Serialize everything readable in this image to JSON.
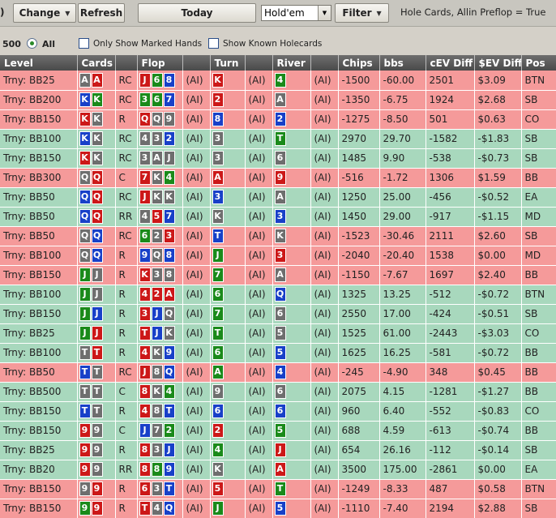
{
  "toolbar": {
    "paren": ")",
    "change_label": "Change",
    "refresh_label": "Refresh",
    "today_label": "Today",
    "game_select": "Hold'em",
    "filter_label": "Filter",
    "filter_desc": "Hole Cards, Allin Preflop = True"
  },
  "options": {
    "count": "500",
    "all_label": "All",
    "marked_label": "Only Show Marked Hands",
    "known_label": "Show Known Holecards"
  },
  "columns": [
    "Level",
    "Cards",
    "",
    "Flop",
    "",
    "Turn",
    "",
    "River",
    "",
    "Chips",
    "bbs",
    "cEV Diff",
    "$EV Diff",
    "Pos"
  ],
  "colors": {
    "spade": "#6e6e6e",
    "heart": "#cc1818",
    "diamond": "#1840c8",
    "club": "#1a8a1a",
    "loss_row": "#f59a9a",
    "win_row": "#a8d8bd"
  },
  "rows": [
    {
      "level": "Trny: BB25",
      "hole": [
        [
          "A",
          "s"
        ],
        [
          "A",
          "h"
        ]
      ],
      "pre": "RC",
      "flop": [
        [
          "J",
          "h"
        ],
        [
          "6",
          "c"
        ],
        [
          "8",
          "d"
        ]
      ],
      "a1": "(AI)",
      "turn": [
        [
          "K",
          "h"
        ]
      ],
      "a2": "(AI)",
      "river": [
        [
          "4",
          "c"
        ]
      ],
      "a3": "(AI)",
      "chips": "-1500",
      "bbs": "-60.00",
      "cev": "2501",
      "dev": "$3.09",
      "pos": "BTN",
      "res": "loss"
    },
    {
      "level": "Trny: BB200",
      "hole": [
        [
          "K",
          "d"
        ],
        [
          "K",
          "c"
        ]
      ],
      "pre": "RC",
      "flop": [
        [
          "3",
          "c"
        ],
        [
          "6",
          "c"
        ],
        [
          "7",
          "d"
        ]
      ],
      "a1": "(AI)",
      "turn": [
        [
          "2",
          "h"
        ]
      ],
      "a2": "(AI)",
      "river": [
        [
          "A",
          "s"
        ]
      ],
      "a3": "(AI)",
      "chips": "-1350",
      "bbs": "-6.75",
      "cev": "1924",
      "dev": "$2.68",
      "pos": "SB",
      "res": "loss"
    },
    {
      "level": "Trny: BB150",
      "hole": [
        [
          "K",
          "h"
        ],
        [
          "K",
          "s"
        ]
      ],
      "pre": "R",
      "flop": [
        [
          "Q",
          "h"
        ],
        [
          "Q",
          "s"
        ],
        [
          "9",
          "s"
        ]
      ],
      "a1": "(AI)",
      "turn": [
        [
          "8",
          "d"
        ]
      ],
      "a2": "(AI)",
      "river": [
        [
          "2",
          "d"
        ]
      ],
      "a3": "(AI)",
      "chips": "-1275",
      "bbs": "-8.50",
      "cev": "501",
      "dev": "$0.63",
      "pos": "CO",
      "res": "loss"
    },
    {
      "level": "Trny: BB100",
      "hole": [
        [
          "K",
          "d"
        ],
        [
          "K",
          "s"
        ]
      ],
      "pre": "RC",
      "flop": [
        [
          "4",
          "s"
        ],
        [
          "3",
          "s"
        ],
        [
          "2",
          "d"
        ]
      ],
      "a1": "(AI)",
      "turn": [
        [
          "3",
          "s"
        ]
      ],
      "a2": "(AI)",
      "river": [
        [
          "T",
          "c"
        ]
      ],
      "a3": "(AI)",
      "chips": "2970",
      "bbs": "29.70",
      "cev": "-1582",
      "dev": "-$1.83",
      "pos": "SB",
      "res": "win"
    },
    {
      "level": "Trny: BB150",
      "hole": [
        [
          "K",
          "h"
        ],
        [
          "K",
          "s"
        ]
      ],
      "pre": "RC",
      "flop": [
        [
          "3",
          "s"
        ],
        [
          "A",
          "s"
        ],
        [
          "J",
          "s"
        ]
      ],
      "a1": "(AI)",
      "turn": [
        [
          "3",
          "s"
        ]
      ],
      "a2": "(AI)",
      "river": [
        [
          "6",
          "s"
        ]
      ],
      "a3": "(AI)",
      "chips": "1485",
      "bbs": "9.90",
      "cev": "-538",
      "dev": "-$0.73",
      "pos": "SB",
      "res": "win"
    },
    {
      "level": "Trny: BB300",
      "hole": [
        [
          "Q",
          "s"
        ],
        [
          "Q",
          "h"
        ]
      ],
      "pre": "C",
      "flop": [
        [
          "7",
          "h"
        ],
        [
          "K",
          "s"
        ],
        [
          "4",
          "c"
        ]
      ],
      "a1": "(AI)",
      "turn": [
        [
          "A",
          "h"
        ]
      ],
      "a2": "(AI)",
      "river": [
        [
          "9",
          "h"
        ]
      ],
      "a3": "(AI)",
      "chips": "-516",
      "bbs": "-1.72",
      "cev": "1306",
      "dev": "$1.59",
      "pos": "BB",
      "res": "loss"
    },
    {
      "level": "Trny: BB50",
      "hole": [
        [
          "Q",
          "d"
        ],
        [
          "Q",
          "h"
        ]
      ],
      "pre": "RC",
      "flop": [
        [
          "J",
          "h"
        ],
        [
          "K",
          "s"
        ],
        [
          "K",
          "s"
        ]
      ],
      "a1": "(AI)",
      "turn": [
        [
          "3",
          "d"
        ]
      ],
      "a2": "(AI)",
      "river": [
        [
          "A",
          "s"
        ]
      ],
      "a3": "(AI)",
      "chips": "1250",
      "bbs": "25.00",
      "cev": "-456",
      "dev": "-$0.52",
      "pos": "EA",
      "res": "win"
    },
    {
      "level": "Trny: BB50",
      "hole": [
        [
          "Q",
          "d"
        ],
        [
          "Q",
          "h"
        ]
      ],
      "pre": "RR",
      "flop": [
        [
          "4",
          "s"
        ],
        [
          "5",
          "h"
        ],
        [
          "7",
          "d"
        ]
      ],
      "a1": "(AI)",
      "turn": [
        [
          "K",
          "s"
        ]
      ],
      "a2": "(AI)",
      "river": [
        [
          "3",
          "d"
        ]
      ],
      "a3": "(AI)",
      "chips": "1450",
      "bbs": "29.00",
      "cev": "-917",
      "dev": "-$1.15",
      "pos": "MD",
      "res": "win"
    },
    {
      "level": "Trny: BB50",
      "hole": [
        [
          "Q",
          "s"
        ],
        [
          "Q",
          "d"
        ]
      ],
      "pre": "RC",
      "flop": [
        [
          "6",
          "c"
        ],
        [
          "2",
          "s"
        ],
        [
          "3",
          "h"
        ]
      ],
      "a1": "(AI)",
      "turn": [
        [
          "T",
          "d"
        ]
      ],
      "a2": "(AI)",
      "river": [
        [
          "K",
          "s"
        ]
      ],
      "a3": "(AI)",
      "chips": "-1523",
      "bbs": "-30.46",
      "cev": "2111",
      "dev": "$2.60",
      "pos": "SB",
      "res": "loss"
    },
    {
      "level": "Trny: BB100",
      "hole": [
        [
          "Q",
          "s"
        ],
        [
          "Q",
          "d"
        ]
      ],
      "pre": "R",
      "flop": [
        [
          "9",
          "d"
        ],
        [
          "Q",
          "s"
        ],
        [
          "8",
          "d"
        ]
      ],
      "a1": "(AI)",
      "turn": [
        [
          "J",
          "c"
        ]
      ],
      "a2": "(AI)",
      "river": [
        [
          "3",
          "h"
        ]
      ],
      "a3": "(AI)",
      "chips": "-2040",
      "bbs": "-20.40",
      "cev": "1538",
      "dev": "$0.00",
      "pos": "MD",
      "res": "loss"
    },
    {
      "level": "Trny: BB150",
      "hole": [
        [
          "J",
          "c"
        ],
        [
          "J",
          "s"
        ]
      ],
      "pre": "R",
      "flop": [
        [
          "K",
          "h"
        ],
        [
          "3",
          "s"
        ],
        [
          "8",
          "s"
        ]
      ],
      "a1": "(AI)",
      "turn": [
        [
          "7",
          "c"
        ]
      ],
      "a2": "(AI)",
      "river": [
        [
          "A",
          "s"
        ]
      ],
      "a3": "(AI)",
      "chips": "-1150",
      "bbs": "-7.67",
      "cev": "1697",
      "dev": "$2.40",
      "pos": "BB",
      "res": "loss"
    },
    {
      "level": "Trny: BB100",
      "hole": [
        [
          "J",
          "c"
        ],
        [
          "J",
          "s"
        ]
      ],
      "pre": "R",
      "flop": [
        [
          "4",
          "h"
        ],
        [
          "2",
          "h"
        ],
        [
          "A",
          "h"
        ]
      ],
      "a1": "(AI)",
      "turn": [
        [
          "6",
          "c"
        ]
      ],
      "a2": "(AI)",
      "river": [
        [
          "Q",
          "d"
        ]
      ],
      "a3": "(AI)",
      "chips": "1325",
      "bbs": "13.25",
      "cev": "-512",
      "dev": "-$0.72",
      "pos": "BTN",
      "res": "win"
    },
    {
      "level": "Trny: BB150",
      "hole": [
        [
          "J",
          "c"
        ],
        [
          "J",
          "d"
        ]
      ],
      "pre": "R",
      "flop": [
        [
          "3",
          "h"
        ],
        [
          "J",
          "d"
        ],
        [
          "Q",
          "s"
        ]
      ],
      "a1": "(AI)",
      "turn": [
        [
          "7",
          "c"
        ]
      ],
      "a2": "(AI)",
      "river": [
        [
          "6",
          "s"
        ]
      ],
      "a3": "(AI)",
      "chips": "2550",
      "bbs": "17.00",
      "cev": "-424",
      "dev": "-$0.51",
      "pos": "SB",
      "res": "win"
    },
    {
      "level": "Trny: BB25",
      "hole": [
        [
          "J",
          "c"
        ],
        [
          "J",
          "h"
        ]
      ],
      "pre": "R",
      "flop": [
        [
          "T",
          "h"
        ],
        [
          "J",
          "d"
        ],
        [
          "K",
          "s"
        ]
      ],
      "a1": "(AI)",
      "turn": [
        [
          "T",
          "c"
        ]
      ],
      "a2": "(AI)",
      "river": [
        [
          "5",
          "s"
        ]
      ],
      "a3": "(AI)",
      "chips": "1525",
      "bbs": "61.00",
      "cev": "-2443",
      "dev": "-$3.03",
      "pos": "CO",
      "res": "win"
    },
    {
      "level": "Trny: BB100",
      "hole": [
        [
          "T",
          "s"
        ],
        [
          "T",
          "h"
        ]
      ],
      "pre": "R",
      "flop": [
        [
          "4",
          "h"
        ],
        [
          "K",
          "s"
        ],
        [
          "9",
          "d"
        ]
      ],
      "a1": "(AI)",
      "turn": [
        [
          "6",
          "c"
        ]
      ],
      "a2": "(AI)",
      "river": [
        [
          "5",
          "d"
        ]
      ],
      "a3": "(AI)",
      "chips": "1625",
      "bbs": "16.25",
      "cev": "-581",
      "dev": "-$0.72",
      "pos": "BB",
      "res": "win"
    },
    {
      "level": "Trny: BB50",
      "hole": [
        [
          "T",
          "d"
        ],
        [
          "T",
          "s"
        ]
      ],
      "pre": "RC",
      "flop": [
        [
          "J",
          "h"
        ],
        [
          "8",
          "s"
        ],
        [
          "Q",
          "d"
        ]
      ],
      "a1": "(AI)",
      "turn": [
        [
          "A",
          "c"
        ]
      ],
      "a2": "(AI)",
      "river": [
        [
          "4",
          "d"
        ]
      ],
      "a3": "(AI)",
      "chips": "-245",
      "bbs": "-4.90",
      "cev": "348",
      "dev": "$0.45",
      "pos": "BB",
      "res": "loss"
    },
    {
      "level": "Trny: BB500",
      "hole": [
        [
          "T",
          "s"
        ],
        [
          "T",
          "s"
        ]
      ],
      "pre": "C",
      "flop": [
        [
          "8",
          "h"
        ],
        [
          "K",
          "s"
        ],
        [
          "4",
          "c"
        ]
      ],
      "a1": "(AI)",
      "turn": [
        [
          "9",
          "s"
        ]
      ],
      "a2": "(AI)",
      "river": [
        [
          "6",
          "s"
        ]
      ],
      "a3": "(AI)",
      "chips": "2075",
      "bbs": "4.15",
      "cev": "-1281",
      "dev": "-$1.27",
      "pos": "BB",
      "res": "win"
    },
    {
      "level": "Trny: BB150",
      "hole": [
        [
          "T",
          "d"
        ],
        [
          "T",
          "s"
        ]
      ],
      "pre": "R",
      "flop": [
        [
          "4",
          "h"
        ],
        [
          "8",
          "s"
        ],
        [
          "T",
          "d"
        ]
      ],
      "a1": "(AI)",
      "turn": [
        [
          "6",
          "d"
        ]
      ],
      "a2": "(AI)",
      "river": [
        [
          "6",
          "d"
        ]
      ],
      "a3": "(AI)",
      "chips": "960",
      "bbs": "6.40",
      "cev": "-552",
      "dev": "-$0.83",
      "pos": "CO",
      "res": "win"
    },
    {
      "level": "Trny: BB150",
      "hole": [
        [
          "9",
          "h"
        ],
        [
          "9",
          "s"
        ]
      ],
      "pre": "C",
      "flop": [
        [
          "J",
          "d"
        ],
        [
          "7",
          "s"
        ],
        [
          "2",
          "c"
        ]
      ],
      "a1": "(AI)",
      "turn": [
        [
          "2",
          "h"
        ]
      ],
      "a2": "(AI)",
      "river": [
        [
          "5",
          "c"
        ]
      ],
      "a3": "(AI)",
      "chips": "688",
      "bbs": "4.59",
      "cev": "-613",
      "dev": "-$0.74",
      "pos": "BB",
      "res": "win"
    },
    {
      "level": "Trny: BB25",
      "hole": [
        [
          "9",
          "h"
        ],
        [
          "9",
          "s"
        ]
      ],
      "pre": "R",
      "flop": [
        [
          "8",
          "h"
        ],
        [
          "3",
          "s"
        ],
        [
          "J",
          "d"
        ]
      ],
      "a1": "(AI)",
      "turn": [
        [
          "4",
          "c"
        ]
      ],
      "a2": "(AI)",
      "river": [
        [
          "J",
          "h"
        ]
      ],
      "a3": "(AI)",
      "chips": "654",
      "bbs": "26.16",
      "cev": "-112",
      "dev": "-$0.14",
      "pos": "SB",
      "res": "win"
    },
    {
      "level": "Trny: BB20",
      "hole": [
        [
          "9",
          "h"
        ],
        [
          "9",
          "s"
        ]
      ],
      "pre": "RR",
      "flop": [
        [
          "8",
          "h"
        ],
        [
          "8",
          "c"
        ],
        [
          "9",
          "d"
        ]
      ],
      "a1": "(AI)",
      "turn": [
        [
          "K",
          "s"
        ]
      ],
      "a2": "(AI)",
      "river": [
        [
          "A",
          "h"
        ]
      ],
      "a3": "(AI)",
      "chips": "3500",
      "bbs": "175.00",
      "cev": "-2861",
      "dev": "$0.00",
      "pos": "EA",
      "res": "win"
    },
    {
      "level": "Trny: BB150",
      "hole": [
        [
          "9",
          "s"
        ],
        [
          "9",
          "h"
        ]
      ],
      "pre": "R",
      "flop": [
        [
          "6",
          "h"
        ],
        [
          "3",
          "s"
        ],
        [
          "T",
          "d"
        ]
      ],
      "a1": "(AI)",
      "turn": [
        [
          "5",
          "h"
        ]
      ],
      "a2": "(AI)",
      "river": [
        [
          "T",
          "c"
        ]
      ],
      "a3": "(AI)",
      "chips": "-1249",
      "bbs": "-8.33",
      "cev": "487",
      "dev": "$0.58",
      "pos": "BTN",
      "res": "loss"
    },
    {
      "level": "Trny: BB150",
      "hole": [
        [
          "9",
          "c"
        ],
        [
          "9",
          "h"
        ]
      ],
      "pre": "R",
      "flop": [
        [
          "T",
          "h"
        ],
        [
          "4",
          "s"
        ],
        [
          "Q",
          "d"
        ]
      ],
      "a1": "(AI)",
      "turn": [
        [
          "J",
          "c"
        ]
      ],
      "a2": "(AI)",
      "river": [
        [
          "5",
          "d"
        ]
      ],
      "a3": "(AI)",
      "chips": "-1110",
      "bbs": "-7.40",
      "cev": "2194",
      "dev": "$2.88",
      "pos": "SB",
      "res": "loss"
    }
  ]
}
